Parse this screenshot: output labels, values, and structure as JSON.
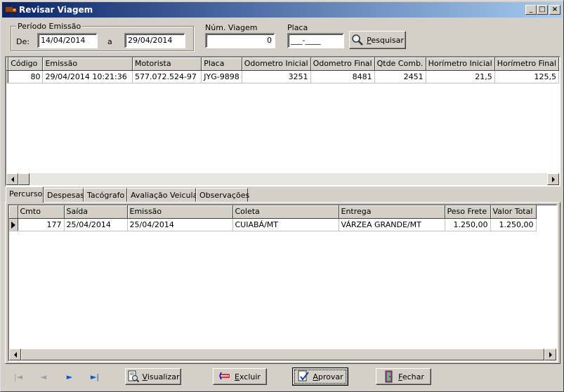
{
  "window": {
    "title": "Revisar Viagem",
    "minimize": "_",
    "maximize": "□",
    "close": "×"
  },
  "filters": {
    "periodo_label": "Período Emissão",
    "de_label": "De:",
    "de_value": "14/04/2014",
    "a_label": "a",
    "ate_value": "29/04/2014",
    "num_viagem_label": "Núm. Viagem",
    "num_viagem_value": "0",
    "placa_label": "Placa",
    "placa_value": "___-____",
    "pesquisar_prefix": "P",
    "pesquisar_rest": "esquisar"
  },
  "viagens": {
    "columns": [
      "Código",
      "Emissão",
      "Motorista",
      "Placa",
      "Odometro Inicial",
      "Odometro Final",
      "Qtde Comb.",
      "Horímetro Inicial",
      "Horímetro Final"
    ],
    "rows": [
      {
        "codigo": "80",
        "emissao": "29/04/2014 10:21:36",
        "motorista": "577.072.524-97",
        "placa": "JYG-9898",
        "odometro_inicial": "3251",
        "odometro_final": "8481",
        "qtde_comb": "2451",
        "horimetro_inicial": "21,5",
        "horimetro_final": "125,5"
      }
    ]
  },
  "tabs": [
    {
      "label": "Percurso",
      "active": true
    },
    {
      "label": "Despesas",
      "active": false
    },
    {
      "label": "Tacógrafo",
      "active": false
    },
    {
      "label": "Avaliação Veicular",
      "active": false
    },
    {
      "label": "Observações",
      "active": false
    }
  ],
  "percurso": {
    "columns": [
      "Cmto",
      "Saída",
      "Emissão",
      "Coleta",
      "Entrega",
      "Peso Frete",
      "Valor Total"
    ],
    "rows": [
      {
        "cmto": "177",
        "saida": "25/04/2014",
        "emissao": "25/04/2014",
        "coleta": "CUIABÁ/MT",
        "entrega": "VÁRZEA GRANDE/MT",
        "peso_frete": "1.250,00",
        "valor_total": "1.250,00"
      }
    ]
  },
  "nav": {
    "first": "|◄",
    "prev": "◄",
    "next": "►",
    "last": "►|"
  },
  "buttons": {
    "visualizar_prefix": "V",
    "visualizar_rest": "isualizar",
    "excluir_prefix": "E",
    "excluir_rest": "xcluir",
    "aprovar_prefix": "A",
    "aprovar_rest": "provar",
    "fechar_prefix": "F",
    "fechar_rest": "echar"
  },
  "colors": {
    "titlebar_start": "#0a246a",
    "titlebar_end": "#a6caf0",
    "face": "#d4d0c8",
    "nav_active": "#0055e5",
    "nav_disabled": "#a0a0a0"
  }
}
